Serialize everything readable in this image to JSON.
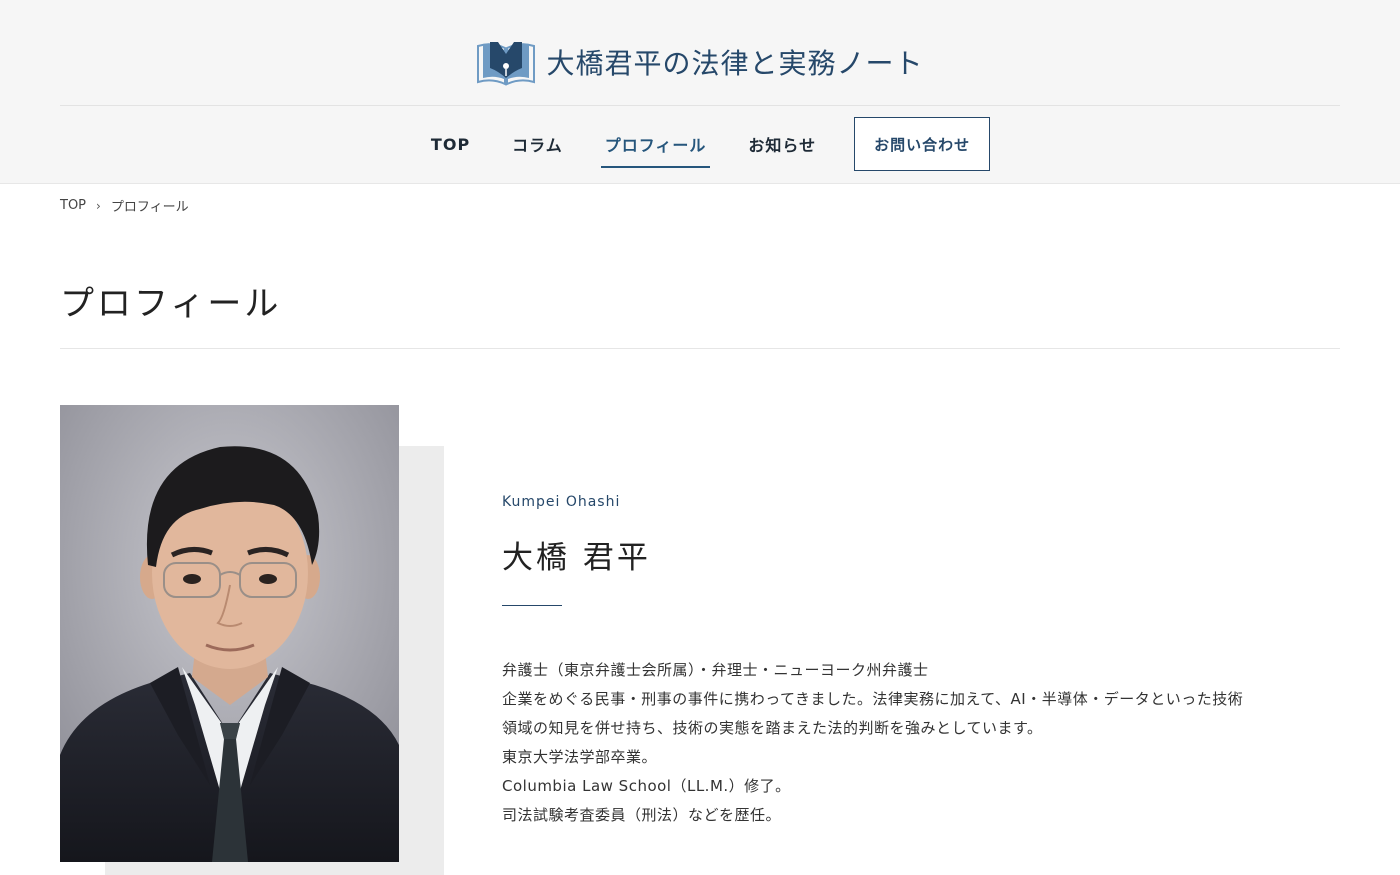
{
  "site": {
    "title": "大橋君平の法律と実務ノート",
    "logo_icon": "book-pen-icon",
    "colors": {
      "brand": "#26486a",
      "accent": "#26567c",
      "logo_light": "#6f9bc4"
    }
  },
  "nav": {
    "items": [
      {
        "label": "TOP"
      },
      {
        "label": "コラム"
      },
      {
        "label": "プロフィール",
        "active": true
      },
      {
        "label": "お知らせ"
      }
    ],
    "contact_label": "お問い合わせ"
  },
  "breadcrumb": {
    "home": "TOP",
    "separator_icon": "chevron-right-icon",
    "separator": "›",
    "current": "プロフィール"
  },
  "page": {
    "title": "プロフィール"
  },
  "profile": {
    "name_en": "Kumpei Ohashi",
    "name_ja": "大橋 君平",
    "bio": [
      "弁護士（東京弁護士会所属）・弁理士・ニューヨーク州弁護士",
      "企業をめぐる民事・刑事の事件に携わってきました。法律実務に加えて、AI・半導体・データといった技術",
      "領域の知見を併せ持ち、技術の実態を踏まえた法的判断を強みとしています。",
      "東京大学法学部卒業。",
      "Columbia Law School（LL.M.）修了。",
      "司法試験考査委員（刑法）などを歴任。"
    ]
  }
}
